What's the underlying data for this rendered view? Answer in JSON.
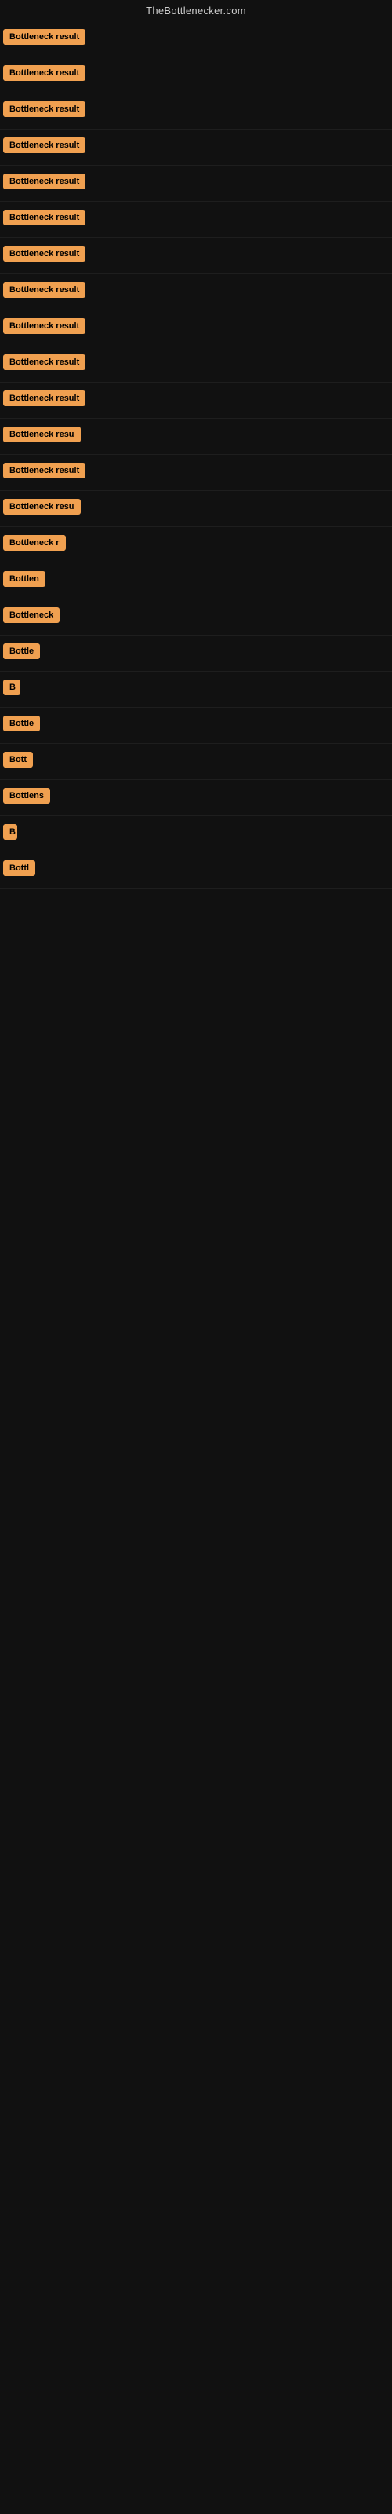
{
  "site": {
    "title": "TheBottlenecker.com"
  },
  "results": [
    {
      "id": 1,
      "label": "Bottleneck result",
      "width": 160
    },
    {
      "id": 2,
      "label": "Bottleneck result",
      "width": 160
    },
    {
      "id": 3,
      "label": "Bottleneck result",
      "width": 160
    },
    {
      "id": 4,
      "label": "Bottleneck result",
      "width": 160
    },
    {
      "id": 5,
      "label": "Bottleneck result",
      "width": 160
    },
    {
      "id": 6,
      "label": "Bottleneck result",
      "width": 156
    },
    {
      "id": 7,
      "label": "Bottleneck result",
      "width": 155
    },
    {
      "id": 8,
      "label": "Bottleneck result",
      "width": 158
    },
    {
      "id": 9,
      "label": "Bottleneck result",
      "width": 155
    },
    {
      "id": 10,
      "label": "Bottleneck result",
      "width": 155
    },
    {
      "id": 11,
      "label": "Bottleneck result",
      "width": 152
    },
    {
      "id": 12,
      "label": "Bottleneck resu",
      "width": 130
    },
    {
      "id": 13,
      "label": "Bottleneck result",
      "width": 152
    },
    {
      "id": 14,
      "label": "Bottleneck resu",
      "width": 128
    },
    {
      "id": 15,
      "label": "Bottleneck r",
      "width": 100
    },
    {
      "id": 16,
      "label": "Bottlen",
      "width": 75
    },
    {
      "id": 17,
      "label": "Bottleneck",
      "width": 88
    },
    {
      "id": 18,
      "label": "Bottle",
      "width": 60
    },
    {
      "id": 19,
      "label": "B",
      "width": 22
    },
    {
      "id": 20,
      "label": "Bottle",
      "width": 60
    },
    {
      "id": 21,
      "label": "Bott",
      "width": 48
    },
    {
      "id": 22,
      "label": "Bottlens",
      "width": 72
    },
    {
      "id": 23,
      "label": "B",
      "width": 18
    },
    {
      "id": 24,
      "label": "Bottl",
      "width": 54
    }
  ],
  "colors": {
    "badge_bg": "#f0a050",
    "badge_text": "#000000",
    "site_title": "#cccccc",
    "background": "#111111"
  }
}
